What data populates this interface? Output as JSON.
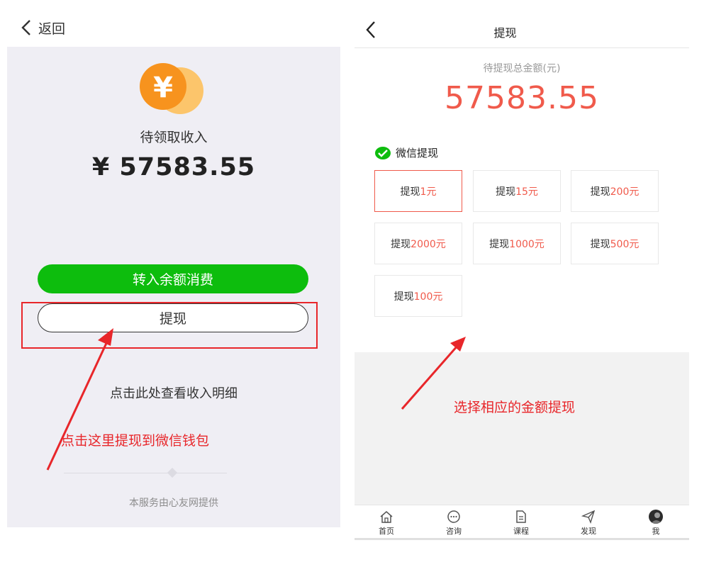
{
  "left": {
    "back_label": "返回",
    "income_label": "待领取收入",
    "income_amount": "¥ 57583.55",
    "balance_button": "转入余额消费",
    "withdraw_button": "提现",
    "detail_link": "点击此处查看收入明细",
    "annotation": "点击这里提现到微信钱包",
    "footer": "本服务由心友网提供",
    "coin_symbol": "¥"
  },
  "right": {
    "title": "提现",
    "total_label": "待提现总金额(元)",
    "total_amount": "57583.55",
    "section_title": "微信提现",
    "options": [
      {
        "prefix": "提现",
        "amount": "1元",
        "selected": true
      },
      {
        "prefix": "提现",
        "amount": "15元",
        "selected": false
      },
      {
        "prefix": "提现",
        "amount": "200元",
        "selected": false
      },
      {
        "prefix": "提现",
        "amount": "2000元",
        "selected": false
      },
      {
        "prefix": "提现",
        "amount": "1000元",
        "selected": false
      },
      {
        "prefix": "提现",
        "amount": "500元",
        "selected": false
      },
      {
        "prefix": "提现",
        "amount": "100元",
        "selected": false
      }
    ],
    "annotation": "选择相应的金额提现",
    "tabs": [
      {
        "label": "首页",
        "icon": "home-icon"
      },
      {
        "label": "咨询",
        "icon": "chat-icon"
      },
      {
        "label": "课程",
        "icon": "document-icon"
      },
      {
        "label": "发现",
        "icon": "paper-plane-icon"
      },
      {
        "label": "我",
        "icon": "avatar"
      }
    ]
  },
  "colors": {
    "accent_red": "#f05a4b",
    "annotation_red": "#e8262a",
    "wechat_green": "#0dbd0d",
    "coin_orange": "#f7931e",
    "coin_light": "#fcc56b"
  }
}
